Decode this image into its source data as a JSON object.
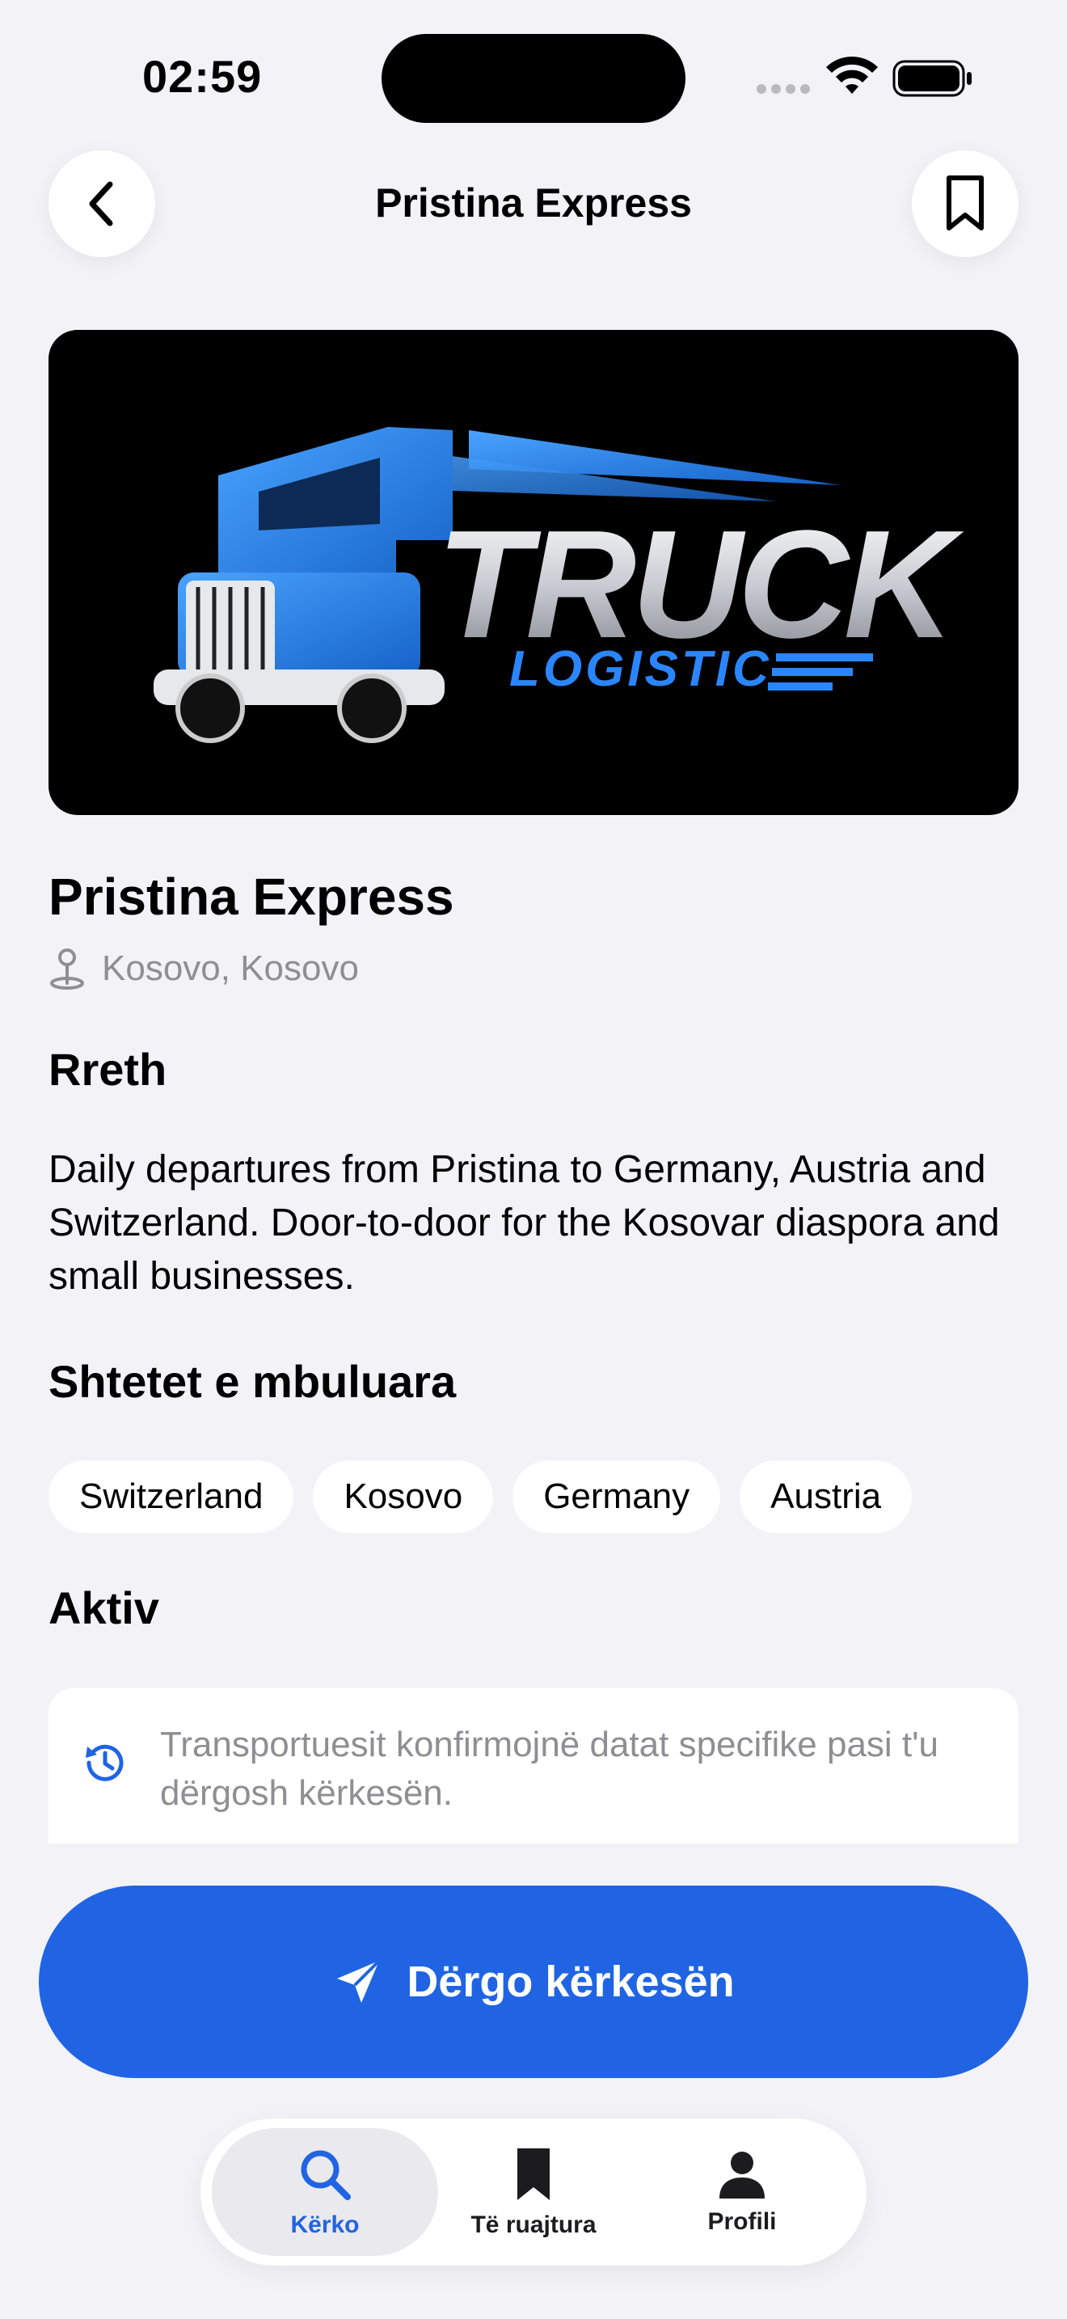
{
  "status_bar": {
    "time": "02:59"
  },
  "nav": {
    "title": "Pristina Express"
  },
  "hero": {
    "logo_word": "TRUCK",
    "logo_sub": "LOGISTIC"
  },
  "company": {
    "name": "Pristina Express",
    "location": "Kosovo, Kosovo"
  },
  "about": {
    "heading": "Rreth",
    "text": "Daily departures from Pristina to Germany, Austria and Switzerland. Door-to-door for the Kosovar diaspora and small businesses."
  },
  "countries": {
    "heading": "Shtetet e mbuluara",
    "items": [
      "Switzerland",
      "Kosovo",
      "Germany",
      "Austria"
    ]
  },
  "active": {
    "heading": "Aktiv",
    "note": "Transportuesit konfirmojnë datat specifike pasi t'u dërgosh kërkesën."
  },
  "cta": {
    "label": "Dërgo kërkesën"
  },
  "tabs": [
    {
      "label": "Kërko",
      "icon": "search-icon",
      "active": true
    },
    {
      "label": "Të ruajtura",
      "icon": "bookmark-icon",
      "active": false
    },
    {
      "label": "Profili",
      "icon": "person-icon",
      "active": false
    }
  ],
  "colors": {
    "accent": "#2064e3",
    "background": "#f2f2f7",
    "muted": "#8e8e93"
  }
}
